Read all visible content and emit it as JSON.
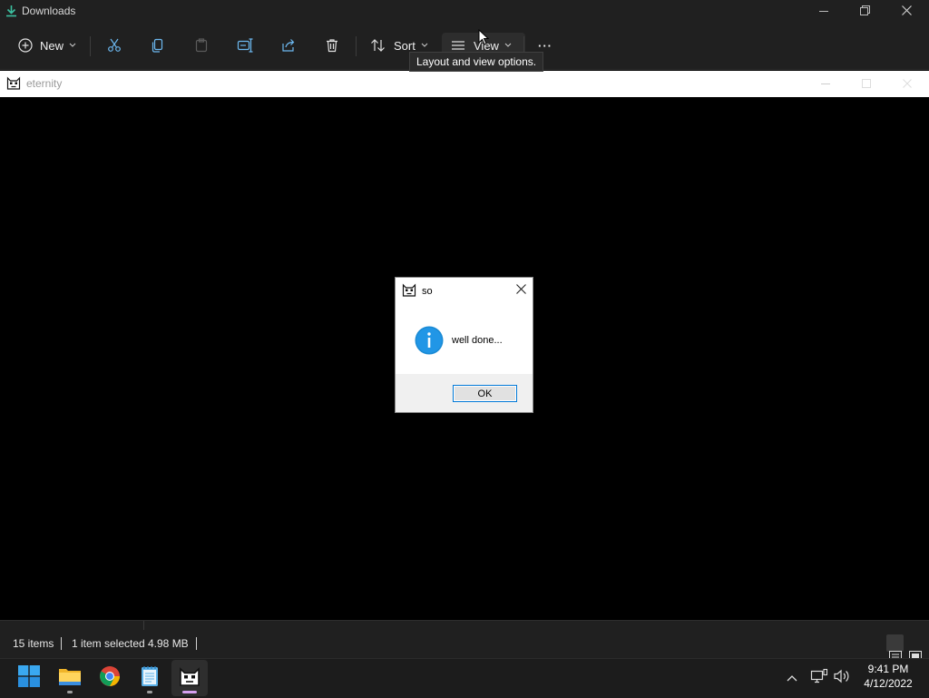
{
  "explorer": {
    "title": "Downloads",
    "toolbar": {
      "new_label": "New",
      "sort_label": "Sort",
      "view_label": "View",
      "more_label": "···"
    },
    "tooltip": "Layout and view options."
  },
  "app_window": {
    "title": "eternity"
  },
  "message_box": {
    "title": "so",
    "message": "well done...",
    "ok_label": "OK"
  },
  "status_bar": {
    "item_count": "15 items",
    "selection": "1 item selected",
    "size": "4.98 MB"
  },
  "taskbar": {
    "apps": [
      "start-icon",
      "file-explorer-icon",
      "chrome-icon",
      "notepad-icon",
      "eternity-app-icon"
    ],
    "time": "9:41 PM",
    "date": "4/12/2022"
  },
  "colors": {
    "accent": "#0078d7",
    "info_blue": "#1a8ad4",
    "explorer_bg": "#202020",
    "taskbar_bg": "#1c1c1c"
  }
}
